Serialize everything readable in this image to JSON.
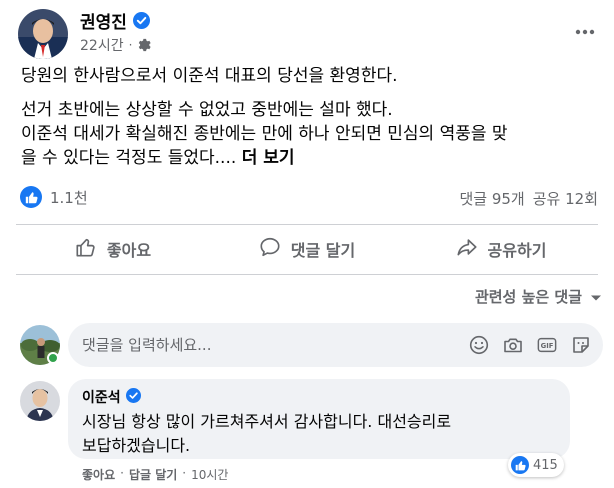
{
  "post": {
    "author": "권영진",
    "time": "22시간",
    "paragraph1": "당원의 한사람으로서 이준석 대표의 당선을 환영한다.",
    "paragraph2_lines": [
      "선거 초반에는 상상할 수 없었고 중반에는 설마 했다.",
      "이준석 대세가 확실해진 종반에는 만에 하나 안되면 민심의 역풍을 맞",
      "을 수 있다는 걱정도 들었다...."
    ],
    "see_more": "더 보기",
    "likes": "1.1천",
    "comments_count": "댓글 95개",
    "shares_count": "공유 12회"
  },
  "actions": {
    "like": "좋아요",
    "comment": "댓글 달기",
    "share": "공유하기"
  },
  "sort_label": "관련성 높은 댓글",
  "composer": {
    "placeholder": "댓글을 입력하세요..."
  },
  "comment": {
    "author": "이준석",
    "text_lines": [
      "시장님 항상 많이 가르쳐주셔서 감사합니다. 대선승리로",
      "보답하겠습니다."
    ],
    "like": "좋아요",
    "reply": "답글 달기",
    "time": "10시간",
    "reactions": "415"
  },
  "colors": {
    "accent": "#1877f2",
    "secondary_text": "#65676b",
    "bubble": "#f0f2f5",
    "online": "#31a24c"
  },
  "icons": [
    "verified-icon",
    "gear-icon",
    "more-icon",
    "like-icon",
    "comment-icon",
    "share-icon",
    "chevron-down-icon",
    "emoji-icon",
    "camera-icon",
    "gif-icon",
    "sticker-icon"
  ]
}
